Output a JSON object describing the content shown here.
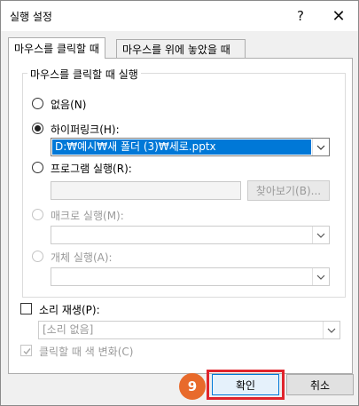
{
  "window": {
    "title": "실행 설정",
    "help_glyph": "?",
    "close_glyph": "✕"
  },
  "tabs": [
    {
      "label": "마우스를 클릭할 때"
    },
    {
      "label": "마우스를 위에 놓았을 때"
    }
  ],
  "group": {
    "title": "마우스를 클릭할 때 실행",
    "options": {
      "none": {
        "label": "없음(N)"
      },
      "hyperlink": {
        "label": "하이퍼링크(H):",
        "value": "D:₩예시₩새 폴더 (3)₩세로.pptx"
      },
      "program": {
        "label": "프로그램 실행(R):",
        "value": "",
        "browse_label": "찾아보기(B)..."
      },
      "macro": {
        "label": "매크로 실행(M):"
      },
      "object": {
        "label": "개체 실행(A):"
      }
    }
  },
  "sound": {
    "label": "소리 재생(P):",
    "value": "[소리 없음]"
  },
  "highlight": {
    "label": "클릭할 때 색 변화(C)"
  },
  "buttons": {
    "ok": "확인",
    "cancel": "취소"
  },
  "annotation": {
    "step": "9"
  },
  "colors": {
    "accent": "#0078d7",
    "highlight_box": "#e0242c",
    "badge": "#e86a2b"
  }
}
